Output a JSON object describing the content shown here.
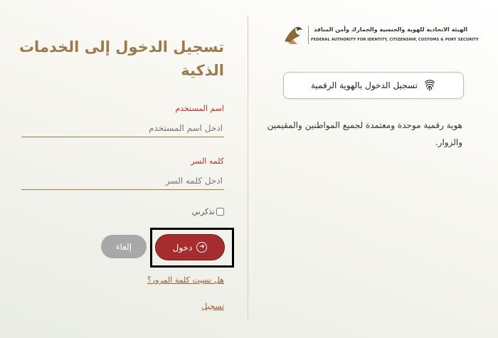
{
  "login_form": {
    "title": "تسجيل الدخول إلى الخدمات الذكية",
    "username": {
      "label": "اسم المستخدم",
      "placeholder": "ادخل اسم المستخدم",
      "value": ""
    },
    "password": {
      "label": "كلمه السر",
      "placeholder": "ادخل كلمه السر",
      "value": ""
    },
    "remember_me": {
      "label": "تذكرني",
      "checked": false
    },
    "login_button": "دخول",
    "cancel_button": "إلغاء",
    "forgot_password_link": "هل نسيت كلمة المرور؟",
    "register_link": "تسجيل"
  },
  "authority": {
    "name_ar": "الهيئة الاتحادية للهوية والجنسية والجمارك وأمن المنافذ",
    "name_en": "FEDERAL AUTHORITY FOR IDENTITY, CITIZENSHIP, CUSTOMS & PORT SECURITY",
    "logo_icon": "falcon-logo-icon"
  },
  "digital_id": {
    "button_label": "تسجيل الدخول بالهوية الرقمية",
    "button_icon": "fingerprint-icon",
    "description": "هوية رقمية موحدة ومعتمدة لجميع المواطنين والمقيمين والزوار."
  },
  "colors": {
    "title_gold": "#9b7a4c",
    "label_red": "#b0322b",
    "login_button": "#a52d2e",
    "cancel_button": "#a8a8a8",
    "highlight_border": "#000000"
  }
}
